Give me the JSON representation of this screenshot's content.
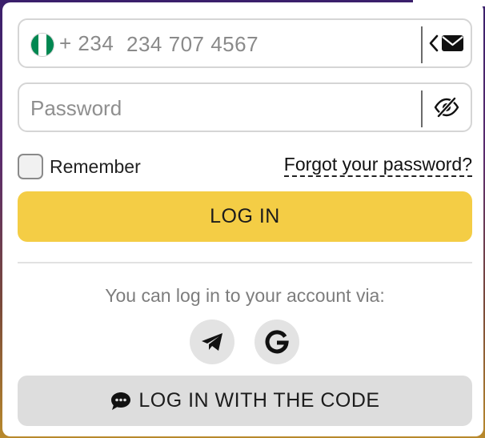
{
  "phone": {
    "country_code": "+ 234",
    "value": "234 707 4567",
    "flag_colors": [
      "#008751",
      "#ffffff",
      "#008751"
    ],
    "switch_icon": "chevron-left-icon",
    "mail_icon": "mail-icon"
  },
  "password": {
    "placeholder": "Password",
    "toggle_icon": "eye-off-icon"
  },
  "remember": {
    "label": "Remember",
    "checked": false
  },
  "forgot_label": "Forgot your password?",
  "login_label": "LOG IN",
  "via_text": "You can log in to your account via:",
  "socials": [
    {
      "name": "telegram",
      "icon": "telegram-icon"
    },
    {
      "name": "google",
      "icon": "google-icon"
    }
  ],
  "code_login_label": "LOG IN WITH THE CODE",
  "colors": {
    "accent": "#f4cd45",
    "secondary_button": "#dddddd",
    "border": "#d5d5d5"
  }
}
